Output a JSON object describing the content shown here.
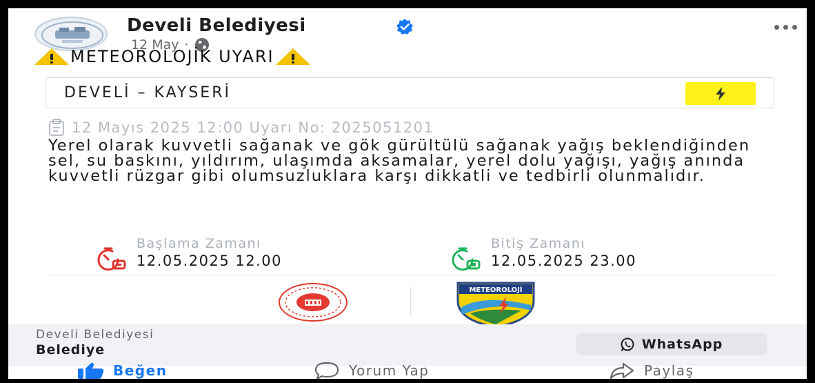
{
  "post": {
    "page_name": "Develi Belediyesi",
    "date": "12 May",
    "separator": "·",
    "headline": "METEOROLOJİK UYARI",
    "location": "DEVELİ – KAYSERİ",
    "date_warning_line": "12 Mayıs 2025 12:00 Uyarı No: 2025051201",
    "body": "Yerel olarak kuvvetli sağanak ve gök gürültülü sağanak yağış beklendiğinden sel, su baskını, yıldırım, ulaşımda aksamalar, yerel dolu yağışı, yağış anında kuvvetli rüzgar gibi olumsuzluklara karşı dikkatli ve tedbirli olunmalıdır.",
    "start_label": "Başlama Zamanı",
    "start_value": "12.05.2025 12.00",
    "end_label": "Bitiş Zamanı",
    "end_value": "12.05.2025 23.00",
    "met_logo_text": "METEOROLOJİ"
  },
  "footer": {
    "page_name": "Develi Belediyesi",
    "category": "Belediye",
    "whatsapp_label": "WhatsApp"
  },
  "actions": {
    "like": "Beğen",
    "comment": "Yorum Yap",
    "share": "Paylaş"
  },
  "icons": {
    "verified": "verified-badge-icon",
    "audience": "globe-icon",
    "more": "more-options-icon",
    "warning": "warning-icon",
    "lightning": "lightning-icon",
    "calendar": "calendar-icon",
    "start_clock": "start-clock-icon",
    "end_clock": "end-clock-icon",
    "whatsapp": "whatsapp-icon",
    "like": "thumbs-up-icon",
    "comment": "comment-icon",
    "share": "share-icon"
  },
  "colors": {
    "accent_blue": "#1877f2",
    "warning_yellow": "#f5c400",
    "bolt_highlight": "#fff21a",
    "start_red": "#e0332c",
    "end_green": "#1fb35a"
  }
}
